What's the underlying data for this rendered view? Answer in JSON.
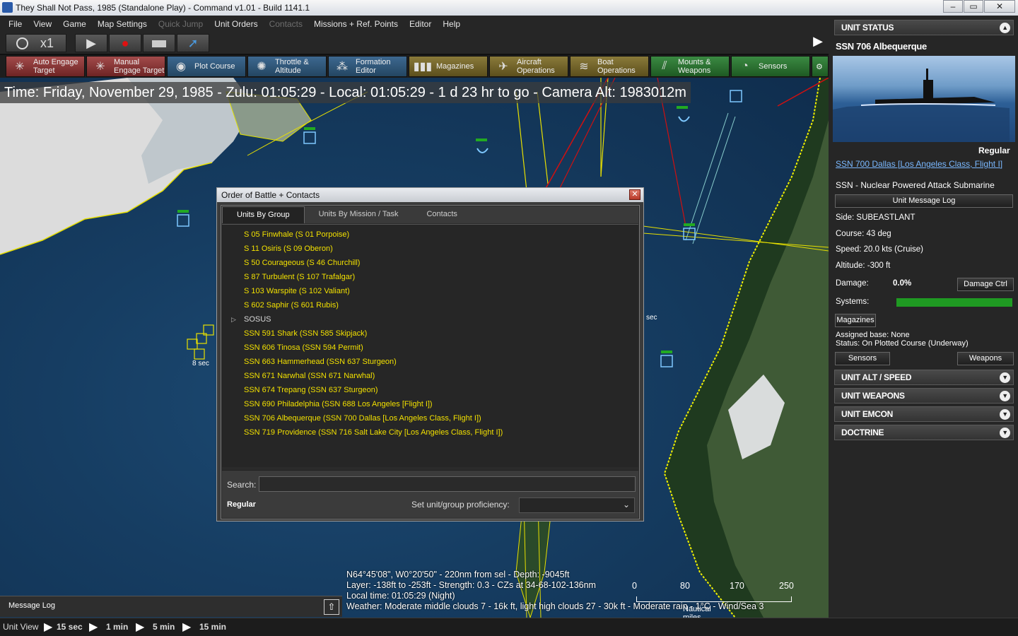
{
  "window": {
    "title": "They Shall Not Pass, 1985 (Standalone Play) - Command v1.01 - Build 1141.1"
  },
  "menu": [
    "File",
    "View",
    "Game",
    "Map Settings",
    "Quick Jump",
    "Unit Orders",
    "Contacts",
    "Missions + Ref. Points",
    "Editor",
    "Help"
  ],
  "menu_disabled": [
    "Quick Jump",
    "Contacts"
  ],
  "time_compression": "x1",
  "toolbar": [
    {
      "l1": "Auto Engage",
      "l2": "Target",
      "icon": "crosshair-icon"
    },
    {
      "l1": "Manual",
      "l2": "Engage Target",
      "icon": "crosshair-manual-icon"
    },
    {
      "l1": "Plot Course",
      "l2": "",
      "icon": "compass-icon"
    },
    {
      "l1": "Throttle &",
      "l2": "Altitude",
      "icon": "gauge-icon"
    },
    {
      "l1": "Formation",
      "l2": "Editor",
      "icon": "formation-icon"
    },
    {
      "l1": "Magazines",
      "l2": "",
      "icon": "ammo-icon"
    },
    {
      "l1": "Aircraft",
      "l2": "Operations",
      "icon": "aircraft-icon"
    },
    {
      "l1": "Boat",
      "l2": "Operations",
      "icon": "boat-icon"
    },
    {
      "l1": "Mounts &",
      "l2": "Weapons",
      "icon": "weapons-icon"
    },
    {
      "l1": "Sensors",
      "l2": "",
      "icon": "radar-icon"
    }
  ],
  "map": {
    "time_line": "Time: Friday, November 29, 1985 - Zulu: 01:05:29 - Local: 01:05:29 - 1 d 23 hr to go -  Camera Alt: 1983012m",
    "unit_time_label": "8 sec",
    "unit_time_label2": "sec",
    "hud": [
      "N64°45'08\", W0°20'50\" - 220nm from sel - Depth: -9045ft",
      "Layer: -138ft to -253ft - Strength: 0.3 - CZs at 34-68-102-136nm",
      "Local time: 01:05:29 (Night)",
      "Weather: Moderate middle clouds 7 - 16k ft, light high clouds 27 - 30k ft - Moderate rain - 1°C - Wind/Sea 3"
    ],
    "scale": {
      "ticks": [
        "0",
        "80",
        "170",
        "250"
      ],
      "unit": "Nautical miles"
    }
  },
  "dialog": {
    "title": "Order of Battle + Contacts",
    "tabs": [
      "Units By Group",
      "Units By Mission / Task",
      "Contacts"
    ],
    "rows": [
      {
        "text": "S 05 Finwhale (S 01 Porpoise)",
        "group": false
      },
      {
        "text": "S 11 Osiris (S 09 Oberon)",
        "group": false
      },
      {
        "text": "S 50 Courageous (S 46 Churchill)",
        "group": false
      },
      {
        "text": "S 87 Turbulent (S 107 Trafalgar)",
        "group": false
      },
      {
        "text": "S 103 Warspite (S 102 Valiant)",
        "group": false
      },
      {
        "text": "S 602 Saphir (S 601 Rubis)",
        "group": false
      },
      {
        "text": "SOSUS",
        "group": true
      },
      {
        "text": "SSN 591 Shark (SSN 585 Skipjack)",
        "group": false
      },
      {
        "text": "SSN 606 Tinosa (SSN 594 Permit)",
        "group": false
      },
      {
        "text": "SSN 663 Hammerhead (SSN 637 Sturgeon)",
        "group": false
      },
      {
        "text": "SSN 671 Narwhal (SSN 671 Narwhal)",
        "group": false
      },
      {
        "text": "SSN 674 Trepang (SSN 637 Sturgeon)",
        "group": false
      },
      {
        "text": "SSN 690 Philadelphia (SSN 688 Los Angeles [Flight I])",
        "group": false
      },
      {
        "text": "SSN 706 Albequerque (SSN 700 Dallas [Los Angeles Class, Flight I])",
        "group": false
      },
      {
        "text": "SSN 719 Providence (SSN 716 Salt Lake City [Los Angeles Class, Flight I])",
        "group": false
      }
    ],
    "search_label": "Search:",
    "search_value": "",
    "proficiency_value": "Regular",
    "proficiency_label": "Set unit/group proficiency:",
    "proficiency_select": ""
  },
  "unit_status": {
    "header": "UNIT STATUS",
    "name": "SSN 706 Albequerque",
    "proficiency": "Regular",
    "class_link": "SSN 700 Dallas [Los Angeles Class, Flight I]",
    "type": "SSN - Nuclear Powered Attack Submarine",
    "message_log_btn": "Unit Message Log",
    "side": "Side: SUBEASTLANT",
    "course": "Course: 43 deg",
    "speed": "Speed: 20.0 kts (Cruise)",
    "altitude": "Altitude: -300 ft",
    "damage_label": "Damage:",
    "damage_value": "0.0%",
    "damage_btn": "Damage Ctrl",
    "systems_label": "Systems:",
    "systems_level": 1.0,
    "magazines_btn": "Magazines",
    "assigned_base": "Assigned base: None",
    "status": "Status: On Plotted Course (Underway)",
    "sensors_btn": "Sensors",
    "weapons_btn": "Weapons"
  },
  "sections": [
    "UNIT ALT / SPEED",
    "UNIT WEAPONS",
    "UNIT EMCON",
    "DOCTRINE"
  ],
  "colors": {
    "accent_yellow": "#f2e000",
    "systems_green": "#1f9a22",
    "panel": "#262626"
  },
  "bottom": {
    "message_log": "Message Log",
    "unit_view": "Unit View",
    "steps": [
      "15 sec",
      "1 min",
      "5 min",
      "15 min"
    ]
  }
}
